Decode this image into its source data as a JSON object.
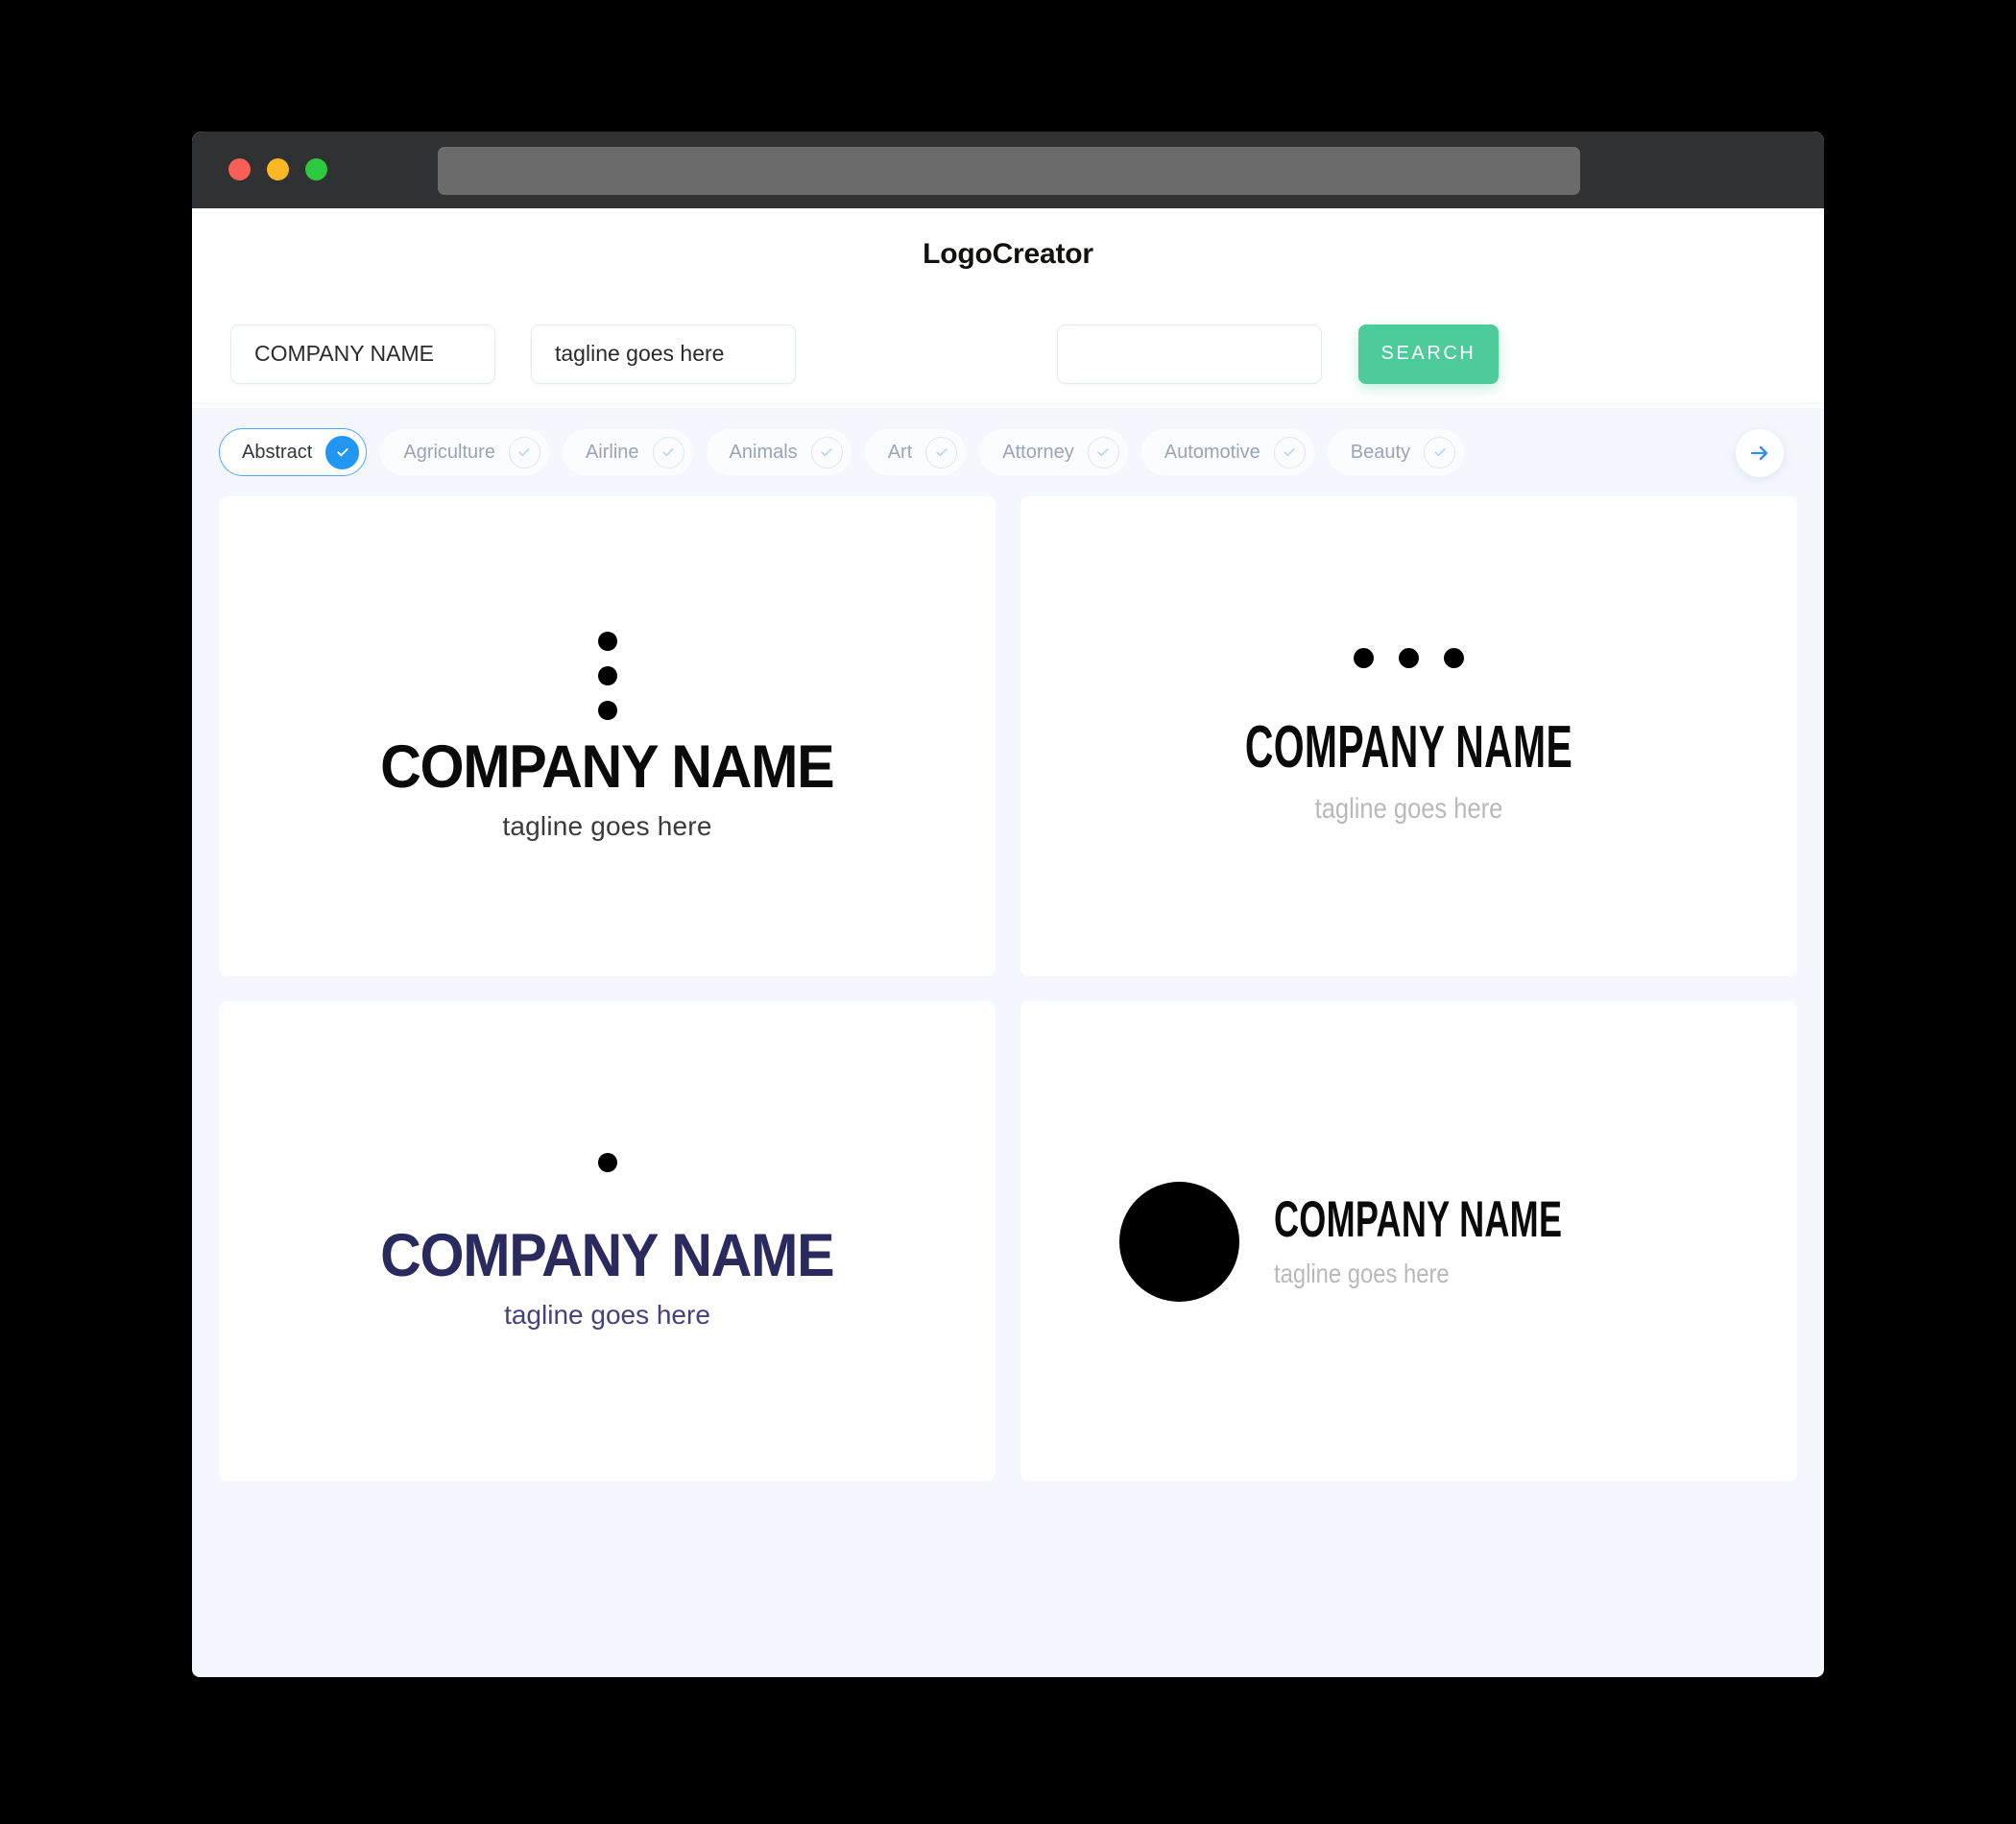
{
  "browser": {
    "traffic_lights": [
      "close",
      "minimize",
      "maximize"
    ],
    "address_bar_value": ""
  },
  "header": {
    "app_title": "LogoCreator"
  },
  "search": {
    "company_value": "COMPANY NAME",
    "company_placeholder": "COMPANY NAME",
    "tagline_value": "tagline goes here",
    "tagline_placeholder": "tagline goes here",
    "extra_value": "",
    "extra_placeholder": "",
    "search_button_label": "SEARCH",
    "search_button_color": "#4ecb9b"
  },
  "categories": {
    "active_color": "#2196f3",
    "next_icon": "arrow-right-icon",
    "items": [
      {
        "label": "Abstract",
        "selected": true
      },
      {
        "label": "Agriculture",
        "selected": false
      },
      {
        "label": "Airline",
        "selected": false
      },
      {
        "label": "Animals",
        "selected": false
      },
      {
        "label": "Art",
        "selected": false
      },
      {
        "label": "Attorney",
        "selected": false
      },
      {
        "label": "Automotive",
        "selected": false
      },
      {
        "label": "Beauty",
        "selected": false
      }
    ]
  },
  "results": {
    "cards": [
      {
        "id": "logo-1",
        "mark": "three-dots-vertical",
        "name": "COMPANY NAME",
        "tagline": "tagline goes here",
        "name_color": "#0a0a0a",
        "tagline_color": "#3b3b3b"
      },
      {
        "id": "logo-2",
        "mark": "three-dots-horizontal",
        "name": "COMPANY NAME",
        "tagline": "tagline goes here",
        "name_color": "#0a0a0a",
        "tagline_color": "#b9b9b9"
      },
      {
        "id": "logo-3",
        "mark": "single-dot",
        "name": "COMPANY NAME",
        "tagline": "tagline goes here",
        "name_color": "#2b2a5e",
        "tagline_color": "#43427a"
      },
      {
        "id": "logo-4",
        "mark": "filled-circle",
        "name": "COMPANY NAME",
        "tagline": "tagline goes here",
        "name_color": "#0a0a0a",
        "tagline_color": "#b9b9b9"
      }
    ]
  }
}
